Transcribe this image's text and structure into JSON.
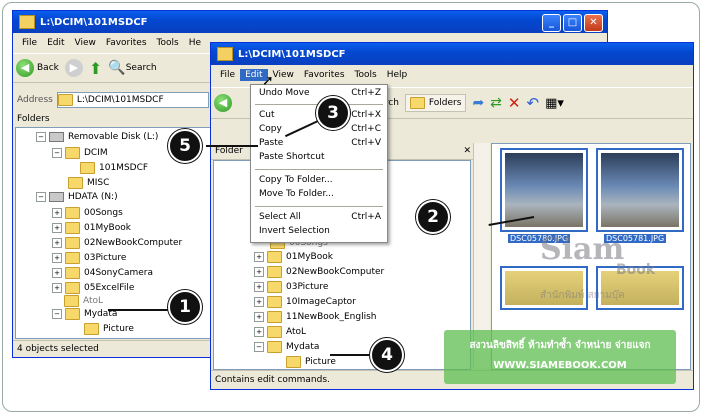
{
  "back_window": {
    "title": "L:\\DCIM\\101MSDCF",
    "menu": [
      "File",
      "Edit",
      "View",
      "Favorites",
      "Tools",
      "He"
    ],
    "toolbar": {
      "back_label": "Back",
      "search_label": "Search"
    },
    "address_label": "Address",
    "address_value": "L:\\DCIM\\101MSDCF",
    "pane_title": "Folders",
    "tree": [
      {
        "pm": "−",
        "label": "Removable Disk (L:)",
        "type": "drive"
      },
      {
        "pm": "−",
        "label": "DCIM",
        "type": "folder"
      },
      {
        "pm": "",
        "label": "101MSDCF",
        "type": "folder"
      },
      {
        "pm": "",
        "label": "MISC",
        "type": "folder"
      },
      {
        "pm": "−",
        "label": "HDATA (N:)",
        "type": "drive"
      },
      {
        "pm": "+",
        "label": "00Songs",
        "type": "folder"
      },
      {
        "pm": "+",
        "label": "01MyBook",
        "type": "folder"
      },
      {
        "pm": "+",
        "label": "02NewBookComputer",
        "type": "folder"
      },
      {
        "pm": "+",
        "label": "03Picture",
        "type": "folder"
      },
      {
        "pm": "+",
        "label": "04SonyCamera",
        "type": "folder"
      },
      {
        "pm": "+",
        "label": "05ExcelFile",
        "type": "folder"
      },
      {
        "pm": "",
        "label": "AtoL",
        "type": "folder"
      },
      {
        "pm": "−",
        "label": "Mydata",
        "type": "folder"
      },
      {
        "pm": "",
        "label": "Picture",
        "type": "folder"
      }
    ],
    "status": "4 objects selected"
  },
  "front_window": {
    "title": "L:\\DCIM\\101MSDCF",
    "menu": [
      "File",
      "Edit",
      "View",
      "Favorites",
      "Tools",
      "Help"
    ],
    "toolbar": {
      "search_label": "Search",
      "folders_label": "Folders"
    },
    "pane_title": "Folder",
    "tree": [
      {
        "pm": "",
        "label": "00Songs"
      },
      {
        "pm": "+",
        "label": "01MyBook"
      },
      {
        "pm": "+",
        "label": "02NewBookComputer"
      },
      {
        "pm": "+",
        "label": "03Picture"
      },
      {
        "pm": "+",
        "label": "10ImageCaptor"
      },
      {
        "pm": "+",
        "label": "11NewBook_English"
      },
      {
        "pm": "+",
        "label": "AtoL"
      },
      {
        "pm": "−",
        "label": "Mydata"
      },
      {
        "pm": "",
        "label": "Picture"
      }
    ],
    "thumbnails": [
      "DSC05780.JPG",
      "DSC05781.JPG"
    ],
    "status": "Contains edit commands."
  },
  "edit_menu": {
    "items": [
      {
        "label": "Undo Move",
        "shortcut": "Ctrl+Z"
      },
      {
        "label": "Cut",
        "shortcut": "Ctrl+X"
      },
      {
        "label": "Copy",
        "shortcut": "Ctrl+C"
      },
      {
        "label": "Paste",
        "shortcut": "Ctrl+V"
      },
      {
        "label": "Paste Shortcut",
        "shortcut": ""
      },
      {
        "label": "Copy To Folder...",
        "shortcut": ""
      },
      {
        "label": "Move To Folder...",
        "shortcut": ""
      },
      {
        "label": "Select All",
        "shortcut": "Ctrl+A"
      },
      {
        "label": "Invert Selection",
        "shortcut": ""
      }
    ]
  },
  "callouts": [
    "1",
    "2",
    "3",
    "4",
    "5"
  ],
  "watermark": {
    "brand": "Siam",
    "brand2": "Book",
    "thai_sub": "สำนักพิมพ์ สยามบุ๊ค",
    "copyright": "สงวนลิขสิทธิ์ ห้ามทำซ้ำ จำหน่าย จ่ายแจก",
    "url": "WWW.SIAMEBOOK.COM"
  },
  "colors": {
    "title_blue": "#0a5fef",
    "selection": "#316ac5",
    "window_bg": "#ece9d8"
  }
}
